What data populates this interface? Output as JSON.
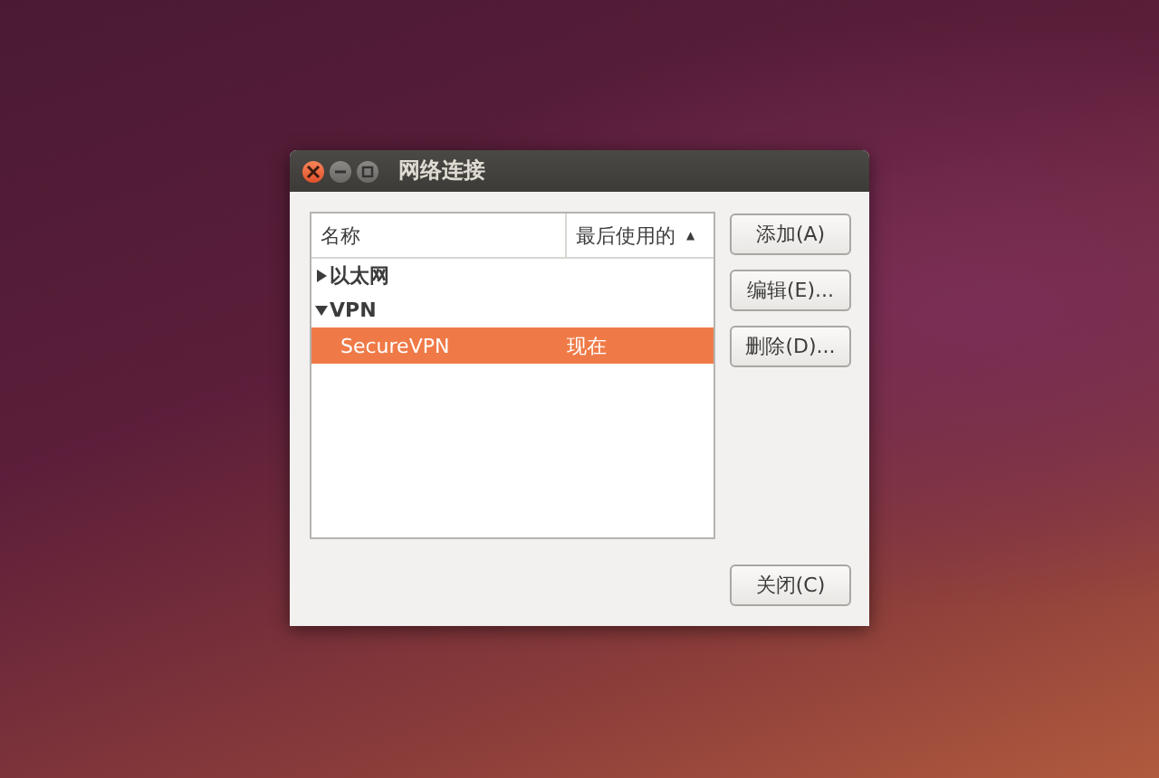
{
  "window": {
    "title": "网络连接"
  },
  "table": {
    "columns": [
      {
        "label": "名称"
      },
      {
        "label": "最后使用的",
        "sort_indicator": "▲"
      }
    ],
    "groups": [
      {
        "label": "以太网",
        "expanded": false
      },
      {
        "label": "VPN",
        "expanded": true,
        "children": [
          {
            "name": "SecureVPN",
            "last_used": "现在",
            "selected": true
          }
        ]
      }
    ]
  },
  "side_buttons": [
    "添加(A)",
    "编辑(E)...",
    "删除(D)..."
  ],
  "close_button": "关闭(C)"
}
